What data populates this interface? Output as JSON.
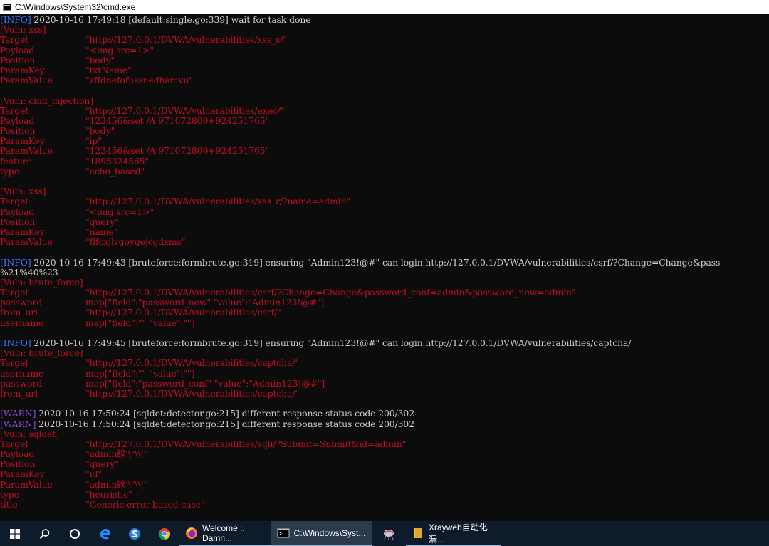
{
  "window": {
    "title": "C:\\Windows\\System32\\cmd.exe"
  },
  "console": [
    {
      "parts": [
        {
          "c": "blue",
          "t": "[INFO]"
        },
        {
          "c": "white",
          "t": " 2020-10-16 17:49:18 [default:single.go:339] wait for task done"
        }
      ]
    },
    {
      "parts": [
        {
          "c": "red",
          "t": "[Vuln: xss]"
        }
      ]
    },
    {
      "k": "Target",
      "v": "\"http://127.0.0.1/DVWA/vulnerabilities/xss_s/\""
    },
    {
      "k": "Payload",
      "v": "\"<img src=1>\""
    },
    {
      "k": "Position",
      "v": "\"body\""
    },
    {
      "k": "ParamKey",
      "v": "\"txtName\""
    },
    {
      "k": "ParamValue",
      "v": "\"zffdnefofussnedhamvu\""
    },
    {
      "blank": true
    },
    {
      "parts": [
        {
          "c": "red",
          "t": "[Vuln: cmd_injection]"
        }
      ]
    },
    {
      "k": "Target",
      "v": "\"http://127.0.0.1/DVWA/vulnerabilities/exec/\""
    },
    {
      "k": "Payload",
      "v": "\"123456&set /A 971072800+924251765\""
    },
    {
      "k": "Position",
      "v": "\"body\""
    },
    {
      "k": "ParamKey",
      "v": "\"ip\""
    },
    {
      "k": "ParamValue",
      "v": "\"123456&set /A 971072800+924251765\""
    },
    {
      "k": "feature",
      "v": "\"1895324565\""
    },
    {
      "k": "type",
      "v": "\"echo_based\""
    },
    {
      "blank": true
    },
    {
      "parts": [
        {
          "c": "red",
          "t": "[Vuln: xss]"
        }
      ]
    },
    {
      "k": "Target",
      "v": "\"http://127.0.0.1/DVWA/vulnerabilities/xss_r/?name=admin\""
    },
    {
      "k": "Payload",
      "v": "\"<img src=1>\""
    },
    {
      "k": "Position",
      "v": "\"query\""
    },
    {
      "k": "ParamKey",
      "v": "\"name\""
    },
    {
      "k": "ParamValue",
      "v": "\"flfcxjlvgoygejcgdxms\""
    },
    {
      "blank": true
    },
    {
      "parts": [
        {
          "c": "blue",
          "t": "[INFO]"
        },
        {
          "c": "white",
          "t": " 2020-10-16 17:49:43 [bruteforce:formbrute.go:319] ensuring \"Admin123!@#\" can login http://127.0.0.1/DVWA/vulnerabilities/csrf/?Change=Change&pass"
        }
      ]
    },
    {
      "parts": [
        {
          "c": "white",
          "t": "%21%40%23"
        }
      ]
    },
    {
      "parts": [
        {
          "c": "red",
          "t": "[Vuln: brute_force]"
        }
      ]
    },
    {
      "k": "Target",
      "v": "\"http://127.0.0.1/DVWA/vulnerabilities/csrf/?Change=Change&password_conf=admin&password_new=admin\""
    },
    {
      "k": "password",
      "v": "map[\"field\":\"password_new\" \"value\":\"Admin123!@#\"]"
    },
    {
      "k": "from_url",
      "v": "\"http://127.0.0.1/DVWA/vulnerabilities/csrf/\""
    },
    {
      "k": "username",
      "v": "map[\"field\":\"\" \"value\":\"\"]"
    },
    {
      "blank": true
    },
    {
      "parts": [
        {
          "c": "blue",
          "t": "[INFO]"
        },
        {
          "c": "white",
          "t": " 2020-10-16 17:49:45 [bruteforce:formbrute.go:319] ensuring \"Admin123!@#\" can login http://127.0.0.1/DVWA/vulnerabilities/captcha/"
        }
      ]
    },
    {
      "parts": [
        {
          "c": "red",
          "t": "[Vuln: brute_force]"
        }
      ]
    },
    {
      "k": "Target",
      "v": "\"http://127.0.0.1/DVWA/vulnerabilities/captcha/\""
    },
    {
      "k": "username",
      "v": "map[\"field\":\"\" \"value\":\"\"]"
    },
    {
      "k": "password",
      "v": "map[\"field\":\"password_conf\" \"value\":\"Admin123!@#\"]"
    },
    {
      "k": "from_url",
      "v": "\"http://127.0.0.1/DVWA/vulnerabilities/captcha/\""
    },
    {
      "blank": true
    },
    {
      "parts": [
        {
          "c": "purple",
          "t": "[WARN]"
        },
        {
          "c": "white",
          "t": " 2020-10-16 17:50:24 [sqldet:detector.go:215] different response status code 200/302"
        }
      ]
    },
    {
      "parts": [
        {
          "c": "purple",
          "t": "[WARN]"
        },
        {
          "c": "white",
          "t": " 2020-10-16 17:50:24 [sqldet:detector.go:215] different response status code 200/302"
        }
      ]
    },
    {
      "parts": [
        {
          "c": "red",
          "t": "[Vuln: sqldet]"
        }
      ]
    },
    {
      "k": "Target",
      "v": "\"http://127.0.0.1/DVWA/vulnerabilities/sqli/?Submit=Submit&id=admin\""
    },
    {
      "k": "Payload",
      "v": "\"admin鍨'\\\"\\\\(\""
    },
    {
      "k": "Position",
      "v": "\"query\""
    },
    {
      "k": "ParamKey",
      "v": "\"id\""
    },
    {
      "k": "ParamValue",
      "v": "\"admin鍨'\\\"\\\\(\""
    },
    {
      "k": "type",
      "v": "\"heuristic\""
    },
    {
      "k": "title",
      "v": "\"Generic error based case\""
    }
  ],
  "taskbar": {
    "start_icon": "windows-logo-icon",
    "search_icon": "search-icon",
    "cortana_icon": "cortana-circle-icon",
    "apps": [
      {
        "icon": "edge-icon"
      },
      {
        "icon": "sogou-icon"
      },
      {
        "icon": "chrome-icon"
      },
      {
        "icon": "firefox-icon",
        "label": "Welcome :: Damn..."
      },
      {
        "icon": "cmd-icon",
        "label": "C:\\Windows\\Syst..."
      },
      {
        "icon": "spider-tool-icon"
      },
      {
        "icon": "folder-icon",
        "label": "Xrayweb自动化漏..."
      }
    ]
  },
  "colors": {
    "console_bg": "#0c0c0c",
    "info": "#3b78ff",
    "vuln": "#c50f1f",
    "warn": "#8a4bd1",
    "text": "#cccccc",
    "taskbar": "#0d1b2b"
  }
}
